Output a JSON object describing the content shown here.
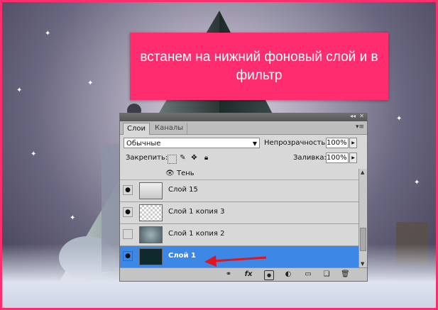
{
  "banner": {
    "text": "встанем на нижний фоновый слой и в фильтр"
  },
  "panel": {
    "tabs": [
      "Слои",
      "Каналы"
    ],
    "blend_mode": "Обычные",
    "opacity_label": "Непрозрачность:",
    "opacity_value": "100%",
    "lock_label": "Закрепить:",
    "fill_label": "Заливка:",
    "fill_value": "100%",
    "effect_label": "Тень",
    "layers": [
      {
        "name": "Слой 15",
        "visible": true,
        "thumb": "people",
        "selected": false
      },
      {
        "name": "Слой 1 копия 3",
        "visible": true,
        "thumb": "transparent",
        "selected": false
      },
      {
        "name": "Слой 1 копия 2",
        "visible": false,
        "thumb": "texture",
        "selected": false
      },
      {
        "name": "Слой 1",
        "visible": true,
        "thumb": "dark",
        "selected": true
      }
    ]
  },
  "colors": {
    "accent": "#ff2d6e",
    "selection": "#3d87e6",
    "arrow": "#e0151f"
  },
  "icons": {
    "lock": [
      "lock-transparency-icon",
      "lock-brush-icon",
      "lock-move-icon",
      "lock-all-icon"
    ],
    "bottom": [
      "link-icon",
      "fx-icon",
      "mask-icon",
      "adjustment-icon",
      "group-folder-icon",
      "new-layer-icon",
      "trash-icon"
    ]
  }
}
